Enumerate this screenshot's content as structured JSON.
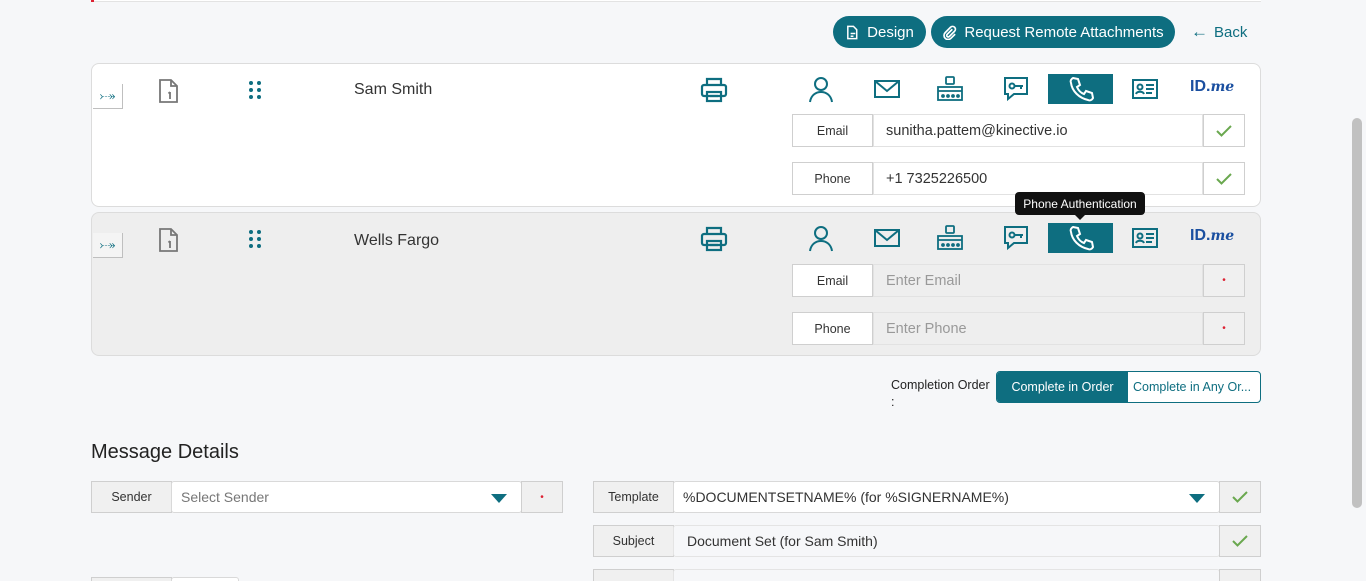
{
  "toolbar": {
    "design_label": "Design",
    "remote_attachments_label": "Request Remote Attachments",
    "back_label": "Back"
  },
  "recipients": [
    {
      "name": "Sam Smith",
      "email_label": "Email",
      "email_value": "sunitha.pattem@kinective.io",
      "phone_label": "Phone",
      "phone_value": "+1 7325226500"
    },
    {
      "name": "Wells Fargo",
      "email_label": "Email",
      "email_placeholder": "Enter Email",
      "phone_label": "Phone",
      "phone_placeholder": "Enter Phone"
    }
  ],
  "auth_icons": [
    "user-icon",
    "mail-icon",
    "otp-keypad-icon",
    "chat-key-icon",
    "phone-icon",
    "id-card-icon"
  ],
  "idme_label": {
    "id": "ID.",
    "me": "me"
  },
  "tooltip": "Phone Authentication",
  "completion_order": {
    "label": "Completion Order",
    "colon": ":",
    "option_in_order": "Complete in Order",
    "option_any_order": "Complete in Any Or..."
  },
  "message_details": {
    "title": "Message Details",
    "sender_label": "Sender",
    "sender_placeholder": "Select Sender",
    "template_label": "Template",
    "template_value": "%DOCUMENTSETNAME% (for %SIGNERNAME%)",
    "subject_label": "Subject",
    "subject_value": "Document Set (for Sam Smith)"
  },
  "colors": {
    "accent": "#0e6e80",
    "check": "#6aa84f",
    "required": "#dd2233"
  }
}
